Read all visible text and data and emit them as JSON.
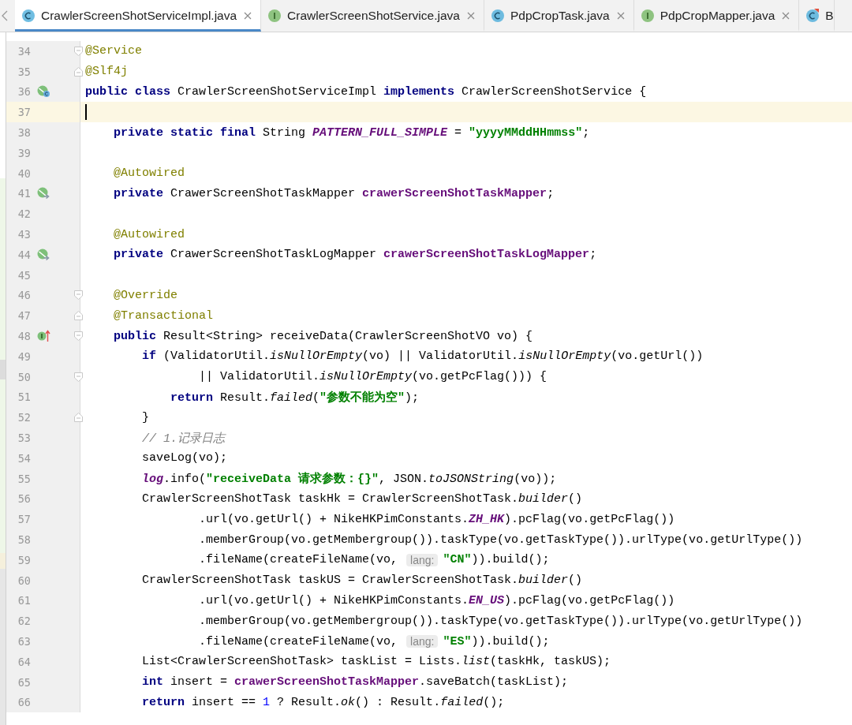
{
  "tabs": [
    {
      "label": "CrawlerScreenShotServiceImpl.java",
      "kind": "class",
      "selected": true,
      "closable": true
    },
    {
      "label": "CrawlerScreenShotService.java",
      "kind": "interface",
      "selected": false,
      "closable": true
    },
    {
      "label": "PdpCropTask.java",
      "kind": "class",
      "selected": false,
      "closable": true
    },
    {
      "label": "PdpCropMapper.java",
      "kind": "interface",
      "selected": false,
      "closable": true
    },
    {
      "label": "B",
      "kind": "class_error",
      "selected": false,
      "closable": false
    }
  ],
  "lines": [
    {
      "number": "34",
      "fold_marker": {
        "kind": "start"
      },
      "tokens": [
        {
          "kind": "ann",
          "text": "@Service"
        }
      ]
    },
    {
      "number": "35",
      "fold_marker": {
        "kind": "end"
      },
      "tokens": [
        {
          "kind": "ann",
          "text": "@Slf4j"
        }
      ]
    },
    {
      "number": "36",
      "gutter_icon": {
        "kind": "implemented"
      },
      "tokens": [
        {
          "kind": "kw",
          "text": "public class"
        },
        {
          "kind": "plain",
          "text": " CrawlerScreenShotServiceImpl "
        },
        {
          "kind": "kw",
          "text": "implements"
        },
        {
          "kind": "plain",
          "text": " CrawlerScreenShotService {"
        }
      ]
    },
    {
      "number": "37",
      "current": true
    },
    {
      "number": "38",
      "tokens": [
        {
          "kind": "kw",
          "text": "    private static final"
        },
        {
          "kind": "plain",
          "text": " String "
        },
        {
          "kind": "sfield",
          "text": "PATTERN_FULL_SIMPLE"
        },
        {
          "kind": "plain",
          "text": " = "
        },
        {
          "kind": "str",
          "text": "\"yyyyMMddHHmmss\""
        },
        {
          "kind": "plain",
          "text": ";"
        }
      ]
    },
    {
      "number": "39"
    },
    {
      "number": "40",
      "tokens": [
        {
          "kind": "ann",
          "text": "    @Autowired"
        }
      ]
    },
    {
      "number": "41",
      "gutter_icon": {
        "kind": "bean"
      },
      "tokens": [
        {
          "kind": "kw",
          "text": "    private"
        },
        {
          "kind": "plain",
          "text": " CrawerScreenShotTaskMapper "
        },
        {
          "kind": "field",
          "text": "crawerScreenShotTaskMapper"
        },
        {
          "kind": "plain",
          "text": ";"
        }
      ]
    },
    {
      "number": "42"
    },
    {
      "number": "43",
      "tokens": [
        {
          "kind": "ann",
          "text": "    @Autowired"
        }
      ]
    },
    {
      "number": "44",
      "gutter_icon": {
        "kind": "bean"
      },
      "tokens": [
        {
          "kind": "kw",
          "text": "    private"
        },
        {
          "kind": "plain",
          "text": " CrawerScreenShotTaskLogMapper "
        },
        {
          "kind": "field",
          "text": "crawerScreenShotTaskLogMapper"
        },
        {
          "kind": "plain",
          "text": ";"
        }
      ]
    },
    {
      "number": "45"
    },
    {
      "number": "46",
      "fold_marker": {
        "kind": "start"
      },
      "tokens": [
        {
          "kind": "ann",
          "text": "    @Override"
        }
      ]
    },
    {
      "number": "47",
      "fold_marker": {
        "kind": "end"
      },
      "tokens": [
        {
          "kind": "ann",
          "text": "    @Transactional"
        }
      ]
    },
    {
      "number": "48",
      "fold_marker": {
        "kind": "start"
      },
      "gutter_icon": {
        "kind": "overrides"
      },
      "tokens": [
        {
          "kind": "kw",
          "text": "    public"
        },
        {
          "kind": "plain",
          "text": " Result<String> receiveData(CrawlerScreenShotVO vo) {"
        }
      ]
    },
    {
      "number": "49",
      "tokens": [
        {
          "kind": "kw",
          "text": "        if"
        },
        {
          "kind": "plain",
          "text": " (ValidatorUtil."
        },
        {
          "kind": "ital",
          "text": "isNullOrEmpty"
        },
        {
          "kind": "plain",
          "text": "(vo) || ValidatorUtil."
        },
        {
          "kind": "ital",
          "text": "isNullOrEmpty"
        },
        {
          "kind": "plain",
          "text": "(vo.getUrl())"
        }
      ]
    },
    {
      "number": "50",
      "fold_marker": {
        "kind": "start"
      },
      "tokens": [
        {
          "kind": "plain",
          "text": "                || ValidatorUtil."
        },
        {
          "kind": "ital",
          "text": "isNullOrEmpty"
        },
        {
          "kind": "plain",
          "text": "(vo.getPcFlag())) {"
        }
      ]
    },
    {
      "number": "51",
      "tokens": [
        {
          "kind": "kw",
          "text": "            return"
        },
        {
          "kind": "plain",
          "text": " Result."
        },
        {
          "kind": "ital",
          "text": "failed"
        },
        {
          "kind": "plain",
          "text": "("
        },
        {
          "kind": "str",
          "text": "\"参数不能为空\""
        },
        {
          "kind": "plain",
          "text": ");"
        }
      ]
    },
    {
      "number": "52",
      "fold_marker": {
        "kind": "end"
      },
      "tokens": [
        {
          "kind": "plain",
          "text": "        }"
        }
      ]
    },
    {
      "number": "53",
      "tokens": [
        {
          "kind": "cmt",
          "text": "        // 1.记录日志"
        }
      ]
    },
    {
      "number": "54",
      "tokens": [
        {
          "kind": "plain",
          "text": "        saveLog(vo);"
        }
      ]
    },
    {
      "number": "55",
      "tokens": [
        {
          "kind": "log",
          "text": "        log"
        },
        {
          "kind": "plain",
          "text": ".info("
        },
        {
          "kind": "str",
          "text": "\"receiveData 请求参数：{}\""
        },
        {
          "kind": "plain",
          "text": ", JSON."
        },
        {
          "kind": "ital",
          "text": "toJSONString"
        },
        {
          "kind": "plain",
          "text": "(vo));"
        }
      ]
    },
    {
      "number": "56",
      "tokens": [
        {
          "kind": "plain",
          "text": "        CrawlerScreenShotTask taskHk = CrawlerScreenShotTask."
        },
        {
          "kind": "ital",
          "text": "builder"
        },
        {
          "kind": "plain",
          "text": "()"
        }
      ]
    },
    {
      "number": "57",
      "tokens": [
        {
          "kind": "plain",
          "text": "                .url(vo.getUrl() + NikeHKPimConstants."
        },
        {
          "kind": "sfield",
          "text": "ZH_HK"
        },
        {
          "kind": "plain",
          "text": ").pcFlag(vo.getPcFlag())"
        }
      ]
    },
    {
      "number": "58",
      "tokens": [
        {
          "kind": "plain",
          "text": "                .memberGroup(vo.getMembergroup()).taskType(vo.getTaskType()).urlType(vo.getUrlType())"
        }
      ]
    },
    {
      "number": "59",
      "tokens": [
        {
          "kind": "plain",
          "text": "                .fileName(createFileName(vo, "
        },
        {
          "kind": "hint",
          "text": "lang:"
        },
        {
          "kind": "str",
          "text": "\"CN\""
        },
        {
          "kind": "plain",
          "text": ")).build();"
        }
      ]
    },
    {
      "number": "60",
      "tokens": [
        {
          "kind": "plain",
          "text": "        CrawlerScreenShotTask taskUS = CrawlerScreenShotTask."
        },
        {
          "kind": "ital",
          "text": "builder"
        },
        {
          "kind": "plain",
          "text": "()"
        }
      ]
    },
    {
      "number": "61",
      "tokens": [
        {
          "kind": "plain",
          "text": "                .url(vo.getUrl() + NikeHKPimConstants."
        },
        {
          "kind": "sfield",
          "text": "EN_US"
        },
        {
          "kind": "plain",
          "text": ").pcFlag(vo.getPcFlag())"
        }
      ]
    },
    {
      "number": "62",
      "tokens": [
        {
          "kind": "plain",
          "text": "                .memberGroup(vo.getMembergroup()).taskType(vo.getTaskType()).urlType(vo.getUrlType())"
        }
      ]
    },
    {
      "number": "63",
      "tokens": [
        {
          "kind": "plain",
          "text": "                .fileName(createFileName(vo, "
        },
        {
          "kind": "hint",
          "text": "lang:"
        },
        {
          "kind": "str",
          "text": "\"ES\""
        },
        {
          "kind": "plain",
          "text": ")).build();"
        }
      ]
    },
    {
      "number": "64",
      "tokens": [
        {
          "kind": "plain",
          "text": "        List<CrawlerScreenShotTask> taskList = Lists."
        },
        {
          "kind": "ital",
          "text": "list"
        },
        {
          "kind": "plain",
          "text": "(taskHk, taskUS);"
        }
      ]
    },
    {
      "number": "65",
      "tokens": [
        {
          "kind": "kw",
          "text": "        int"
        },
        {
          "kind": "plain",
          "text": " insert = "
        },
        {
          "kind": "field",
          "text": "crawerScreenShotTaskMapper"
        },
        {
          "kind": "plain",
          "text": ".saveBatch(taskList);"
        }
      ]
    },
    {
      "number": "66",
      "tokens": [
        {
          "kind": "kw",
          "text": "        return"
        },
        {
          "kind": "plain",
          "text": " insert == "
        },
        {
          "kind": "num",
          "text": "1"
        },
        {
          "kind": "plain",
          "text": " ? Result."
        },
        {
          "kind": "ital",
          "text": "ok"
        },
        {
          "kind": "plain",
          "text": "() : Result."
        },
        {
          "kind": "ital",
          "text": "failed"
        },
        {
          "kind": "plain",
          "text": "();"
        }
      ]
    }
  ]
}
